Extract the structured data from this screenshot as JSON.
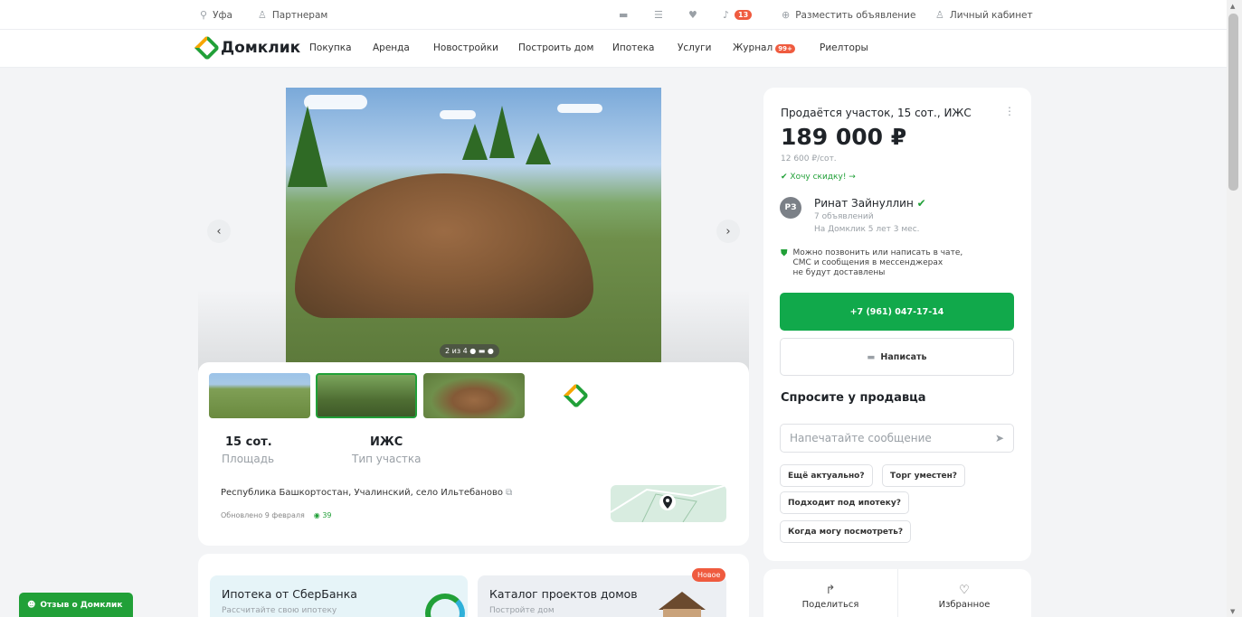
{
  "topbar": {
    "city": "Уфа",
    "partners": "Партнерам",
    "notifications_count": "13",
    "post_ad": "Разместить объявление",
    "cabinet": "Личный кабинет"
  },
  "nav": {
    "logo": "Домклик",
    "items": [
      "Покупка",
      "Аренда",
      "Новостройки",
      "Построить дом",
      "Ипотека",
      "Услуги",
      "Журнал",
      "Риелторы"
    ],
    "journal_badge": "99+"
  },
  "gallery": {
    "counter": "2 из 4",
    "prev_icon": "chevron-left-icon",
    "next_icon": "chevron-right-icon"
  },
  "listing": {
    "area_value": "15 сот.",
    "area_label": "Площадь",
    "type_value": "ИЖС",
    "type_label": "Тип участка",
    "address": "Республика Башкортостан, Учалинский, село Ильтебаново",
    "updated": "Обновлено 9 февраля",
    "views": "39"
  },
  "promos": [
    {
      "title": "Ипотека от СберБанка",
      "subtitle": "Рассчитайте свою ипотеку"
    },
    {
      "title": "Каталог проектов домов",
      "subtitle": "Постройте дом",
      "badge": "Новое"
    }
  ],
  "offer": {
    "title": "Продаётся участок, 15 сот., ИЖС",
    "price": "189 000 ₽",
    "price_per": "12 600 ₽/сот.",
    "discount": "Хочу скидку! →"
  },
  "seller": {
    "initials": "РЗ",
    "name": "Ринат Зайнуллин",
    "ads": "7 объявлений",
    "tenure": "На Домклик 5 лет 3 мес."
  },
  "contact_note": [
    "Можно позвонить или написать в чате,",
    "СМС и сообщения в мессенджерах",
    "не будут доставлены"
  ],
  "phone": "+7 (961) 047-17-14",
  "write": "Написать",
  "ask": {
    "title": "Спросите у продавца",
    "placeholder": "Напечатайте сообщение",
    "chips": [
      "Ещё актуально?",
      "Торг уместен?",
      "Подходит под ипотеку?",
      "Когда могу посмотреть?"
    ]
  },
  "actions": {
    "share": "Поделиться",
    "favorite": "Избранное"
  },
  "feedback": "Отзыв о Домклик",
  "colors": {
    "brand_green": "#21a038",
    "phone_green": "#11a94b",
    "badge_red": "#ef5b3f"
  }
}
